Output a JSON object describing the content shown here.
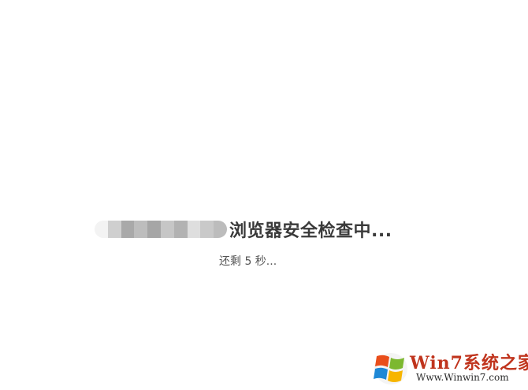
{
  "page": {
    "title": "浏览器安全检查中...",
    "countdown_text": "还剩 5 秒..."
  },
  "redaction": {
    "colors": [
      "#f3f3f3",
      "#cfcfcf",
      "#a9a9a9",
      "#bdbdbd",
      "#a6a6a6",
      "#c6c6c6",
      "#b2b2b2",
      "#dedede",
      "#c9c9c9",
      "#bcbcbc"
    ]
  },
  "watermark": {
    "brand": "Win7系统之家",
    "url": "Www.Winwin7.com",
    "logo_icon": "windows-logo-icon"
  }
}
